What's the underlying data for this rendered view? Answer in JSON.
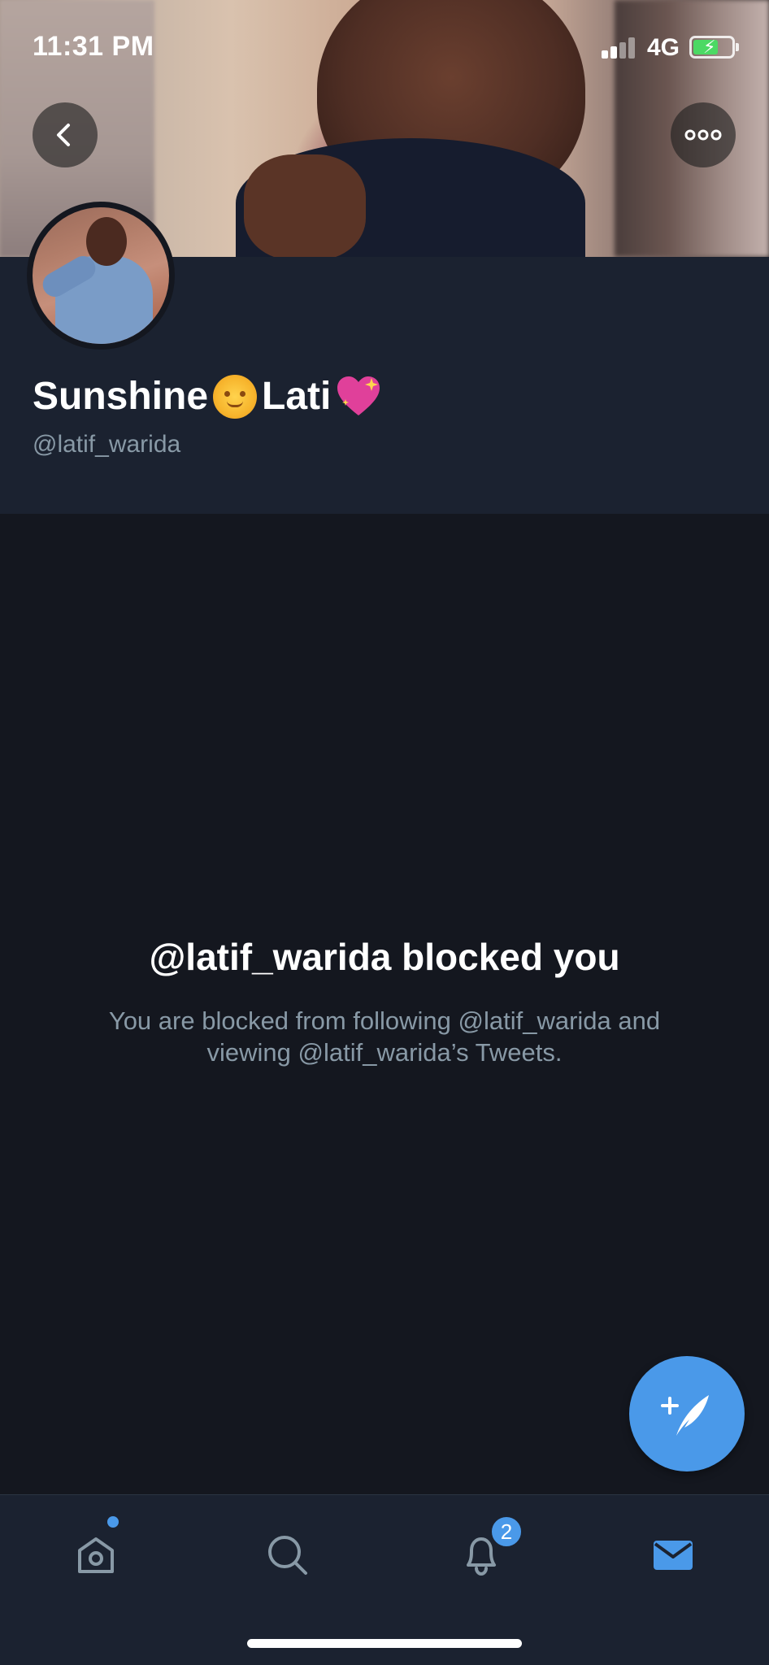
{
  "status_bar": {
    "time": "11:31 PM",
    "network": "4G"
  },
  "header": {
    "back_icon": "chevron-left-icon",
    "more_icon": "more-horizontal-icon"
  },
  "profile": {
    "name_part_1": "Sunshine",
    "name_part_2": "Lati",
    "name_emojis": [
      "sun-with-face-emoji",
      "sparkling-heart-emoji"
    ],
    "handle": "@latif_warida"
  },
  "blocked": {
    "title": "@latif_warida blocked you",
    "subtitle": "You are blocked from following @latif_warida and viewing @latif_warida’s Tweets."
  },
  "fab": {
    "icon": "compose-tweet-icon"
  },
  "bottom_nav": {
    "items": [
      {
        "name": "home",
        "icon": "home-icon",
        "has_dot": true
      },
      {
        "name": "search",
        "icon": "search-icon"
      },
      {
        "name": "notifications",
        "icon": "bell-icon",
        "badge": "2"
      },
      {
        "name": "messages",
        "icon": "mail-icon",
        "active": true
      }
    ]
  },
  "colors": {
    "accent": "#4a99e9",
    "background": "#14171f",
    "surface": "#1b2230",
    "secondary_text": "#8899a6"
  }
}
